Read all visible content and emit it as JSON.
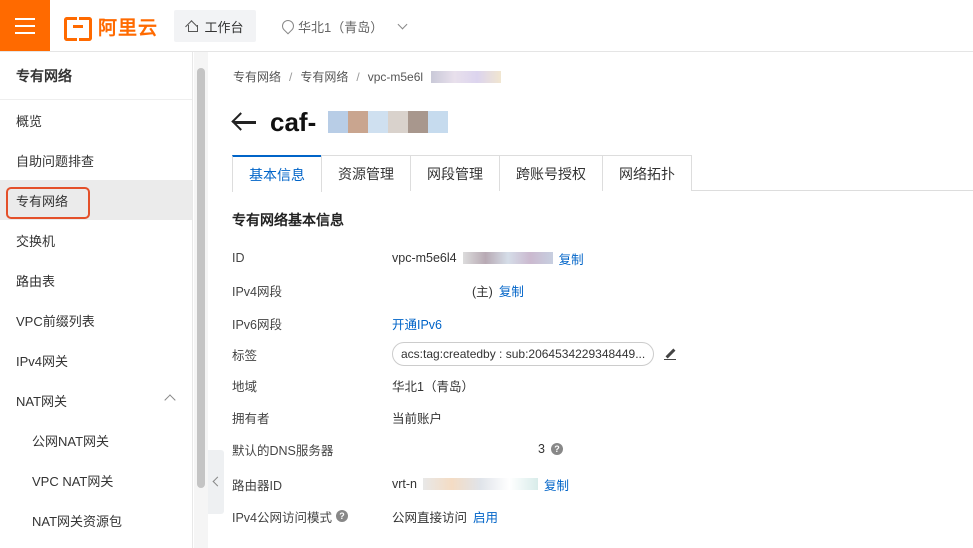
{
  "topbar": {
    "logo_text": "阿里云",
    "workbench_label": "工作台",
    "region_label": "华北1（青岛）"
  },
  "sidebar": {
    "title": "专有网络",
    "items": [
      {
        "label": "概览"
      },
      {
        "label": "自助问题排查"
      },
      {
        "label": "专有网络"
      },
      {
        "label": "交换机"
      },
      {
        "label": "路由表"
      },
      {
        "label": "VPC前缀列表"
      },
      {
        "label": "IPv4网关"
      },
      {
        "label": "NAT网关"
      },
      {
        "label": "公网NAT网关"
      },
      {
        "label": "VPC NAT网关"
      },
      {
        "label": "NAT网关资源包"
      }
    ],
    "active_item": "专有网络"
  },
  "breadcrumb": [
    "专有网络",
    "专有网络",
    "vpc-m5e6l"
  ],
  "page_title": "caf-",
  "tabs": [
    "基本信息",
    "资源管理",
    "网段管理",
    "跨账号授权",
    "网络拓扑"
  ],
  "active_tab": "基本信息",
  "section_title": "专有网络基本信息",
  "details": {
    "id_label": "ID",
    "id_value": "vpc-m5e6l4",
    "id_copy": "复制",
    "ipv4_label": "IPv4网段",
    "ipv4_primary": "(主)",
    "ipv4_copy": "复制",
    "ipv6_label": "IPv6网段",
    "ipv6_link": "开通IPv6",
    "tag_label": "标签",
    "tag_value": "acs:tag:createdby : sub:2064534229348449...",
    "region_label": "地域",
    "region_value": "华北1（青岛）",
    "owner_label": "拥有者",
    "owner_value": "当前账户",
    "dns_label": "默认的DNS服务器",
    "dns_value": "3",
    "router_label": "路由器ID",
    "router_value": "vrt-n",
    "router_copy": "复制",
    "ipv4_access_label": "IPv4公网访问模式",
    "ipv4_access_value": "公网直接访问",
    "ipv4_access_link": "启用"
  },
  "colors": {
    "brand": "#ff6a00",
    "link": "#0064c8",
    "active_highlight": "#e4502a"
  }
}
